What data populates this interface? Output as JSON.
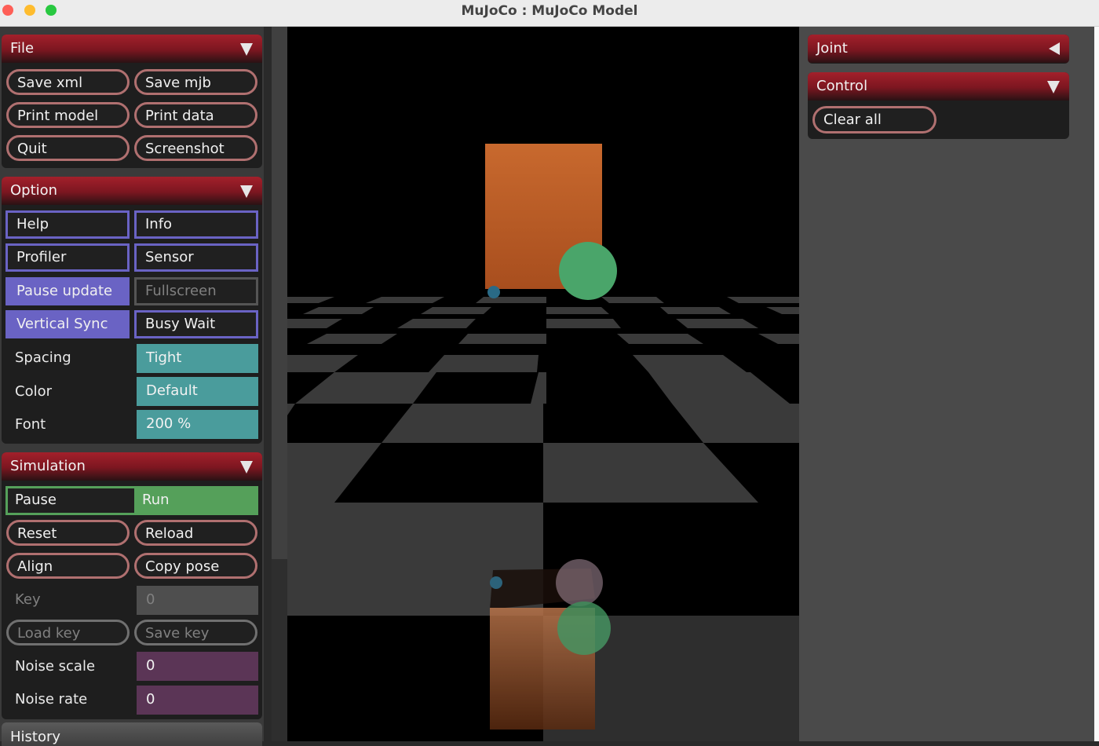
{
  "window": {
    "title": "MuJoCo : MuJoCo Model"
  },
  "file": {
    "title": "File",
    "save_xml": "Save xml",
    "save_mjb": "Save mjb",
    "print_model": "Print model",
    "print_data": "Print data",
    "quit": "Quit",
    "screenshot": "Screenshot"
  },
  "option": {
    "title": "Option",
    "help": "Help",
    "info": "Info",
    "profiler": "Profiler",
    "sensor": "Sensor",
    "pause_update": "Pause update",
    "fullscreen": "Fullscreen",
    "vertical_sync": "Vertical Sync",
    "busy_wait": "Busy Wait",
    "spacing_label": "Spacing",
    "spacing_value": "Tight",
    "color_label": "Color",
    "color_value": "Default",
    "font_label": "Font",
    "font_value": "200 %"
  },
  "simulation": {
    "title": "Simulation",
    "pause": "Pause",
    "run": "Run",
    "reset": "Reset",
    "reload": "Reload",
    "align": "Align",
    "copy_pose": "Copy pose",
    "key_label": "Key",
    "key_value": "0",
    "load_key": "Load key",
    "save_key": "Save key",
    "noise_scale_label": "Noise scale",
    "noise_scale_value": "0",
    "noise_rate_label": "Noise rate",
    "noise_rate_value": "0"
  },
  "history": {
    "title": "History"
  },
  "joint": {
    "title": "Joint"
  },
  "control": {
    "title": "Control",
    "clear_all": "Clear all"
  },
  "colors": {
    "header_red": "#a3202b",
    "pill_border": "#b07070",
    "option_purple": "#6a63c4",
    "teal": "#4a9c9c",
    "run_green": "#55a05a",
    "noise_purple": "#5b3556",
    "box_orange": "#c8692e",
    "sphere_green": "#4aa56a"
  }
}
